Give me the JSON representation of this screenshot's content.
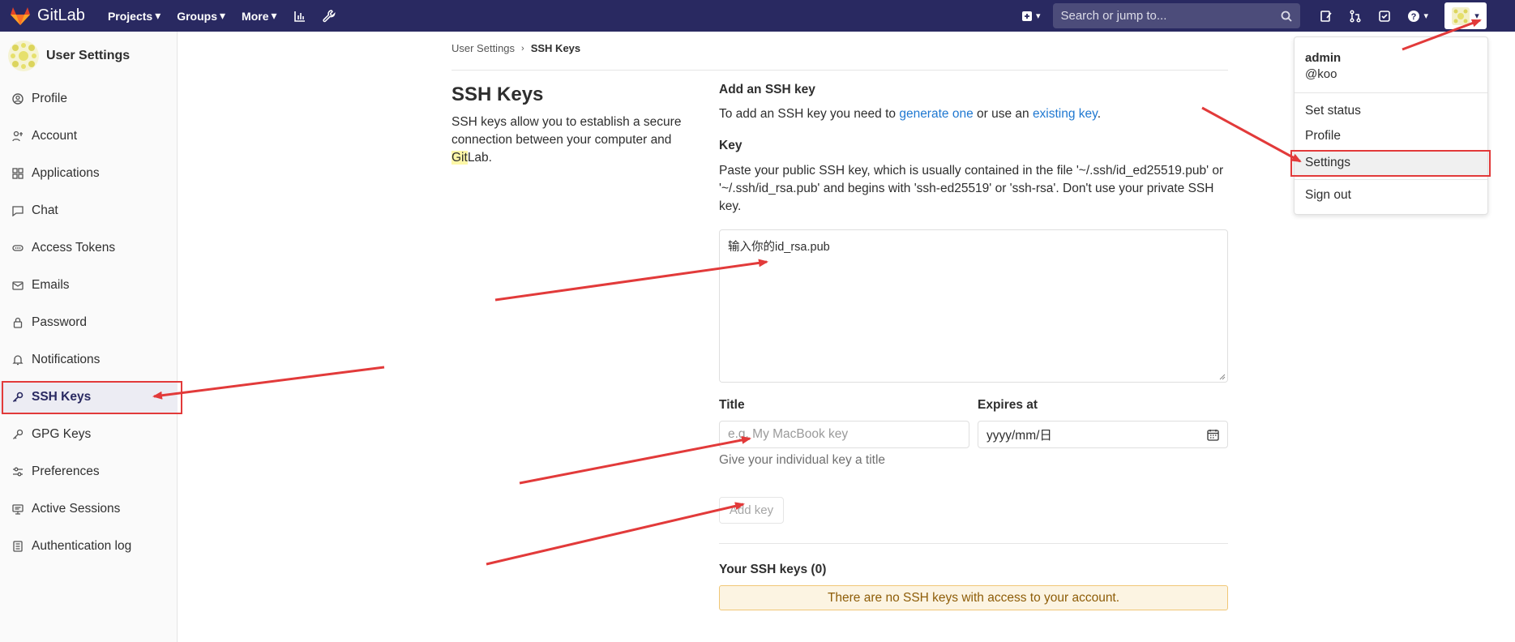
{
  "navbar": {
    "brand": "GitLab",
    "menu": [
      {
        "label": "Projects"
      },
      {
        "label": "Groups"
      },
      {
        "label": "More"
      }
    ],
    "search_placeholder": "Search or jump to...",
    "bg_color": "#292961"
  },
  "sidebar": {
    "title": "User Settings",
    "items": [
      {
        "label": "Profile",
        "icon": "profile-icon"
      },
      {
        "label": "Account",
        "icon": "account-icon"
      },
      {
        "label": "Applications",
        "icon": "applications-icon"
      },
      {
        "label": "Chat",
        "icon": "chat-icon"
      },
      {
        "label": "Access Tokens",
        "icon": "access-tokens-icon"
      },
      {
        "label": "Emails",
        "icon": "mail-icon"
      },
      {
        "label": "Password",
        "icon": "lock-icon"
      },
      {
        "label": "Notifications",
        "icon": "bell-icon"
      },
      {
        "label": "SSH Keys",
        "icon": "key-icon",
        "active": true
      },
      {
        "label": "GPG Keys",
        "icon": "key-icon"
      },
      {
        "label": "Preferences",
        "icon": "preferences-icon"
      },
      {
        "label": "Active Sessions",
        "icon": "monitor-icon"
      },
      {
        "label": "Authentication log",
        "icon": "log-icon"
      }
    ]
  },
  "breadcrumb": {
    "parent": "User Settings",
    "current": "SSH Keys"
  },
  "page": {
    "title": "SSH Keys",
    "description_before": "SSH keys allow you to establish a secure connection between your computer and ",
    "description_highlight": "Git",
    "description_after": "Lab."
  },
  "add_key": {
    "heading": "Add an SSH key",
    "intro_before": "To add an SSH key you need to ",
    "intro_link1": "generate one",
    "intro_middle": " or use an ",
    "intro_link2": "existing key",
    "intro_after": ".",
    "key_label": "Key",
    "key_help": "Paste your public SSH key, which is usually contained in the file '~/.ssh/id_ed25519.pub' or '~/.ssh/id_rsa.pub' and begins with 'ssh-ed25519' or 'ssh-rsa'. Don't use your private SSH key.",
    "key_value": "输入你的id_rsa.pub",
    "title_label": "Title",
    "title_placeholder": "e.g. My MacBook key",
    "title_help": "Give your individual key a title",
    "expires_label": "Expires at",
    "expires_value": "yyyy/mm/日",
    "submit_label": "Add key"
  },
  "your_keys": {
    "heading": "Your SSH keys (0)",
    "empty_message": "There are no SSH keys with access to your account."
  },
  "user_dropdown": {
    "name": "admin",
    "username": "@koo",
    "items": [
      {
        "label": "Set status"
      },
      {
        "label": "Profile"
      },
      {
        "label": "Settings",
        "highlighted": true
      },
      {
        "label": "Sign out"
      }
    ]
  },
  "annotation_color": "#e23a3a"
}
